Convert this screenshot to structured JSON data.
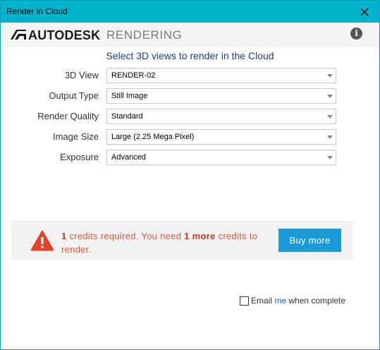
{
  "window": {
    "title": "Render in Cloud"
  },
  "brand": {
    "logo": "AUTODESK",
    "product": "RENDERING",
    "info_icon": "i"
  },
  "subtitle": "Select 3D views to render in the Cloud",
  "form": [
    {
      "label": "3D View",
      "value": "RENDER-02"
    },
    {
      "label": "Output Type",
      "value": "Still Image"
    },
    {
      "label": "Render Quality",
      "value": "Standard"
    },
    {
      "label": "Image Size",
      "value": "Large (2.25 Mega Pixel)"
    },
    {
      "label": "Exposure",
      "value": "Advanced"
    }
  ],
  "alert": {
    "required_count": "1",
    "text_a": " credits required. You need ",
    "more_count": "1 more",
    "text_b": " credits to render.",
    "button": "Buy more"
  },
  "email": {
    "text_a": "Email ",
    "me": "me",
    "text_b": " when complete",
    "checked": false
  },
  "colors": {
    "titlebar": "#00b3cc",
    "alert_text": "#d4573a",
    "button": "#1a9ad6",
    "subtitle": "#1a3a8c"
  }
}
